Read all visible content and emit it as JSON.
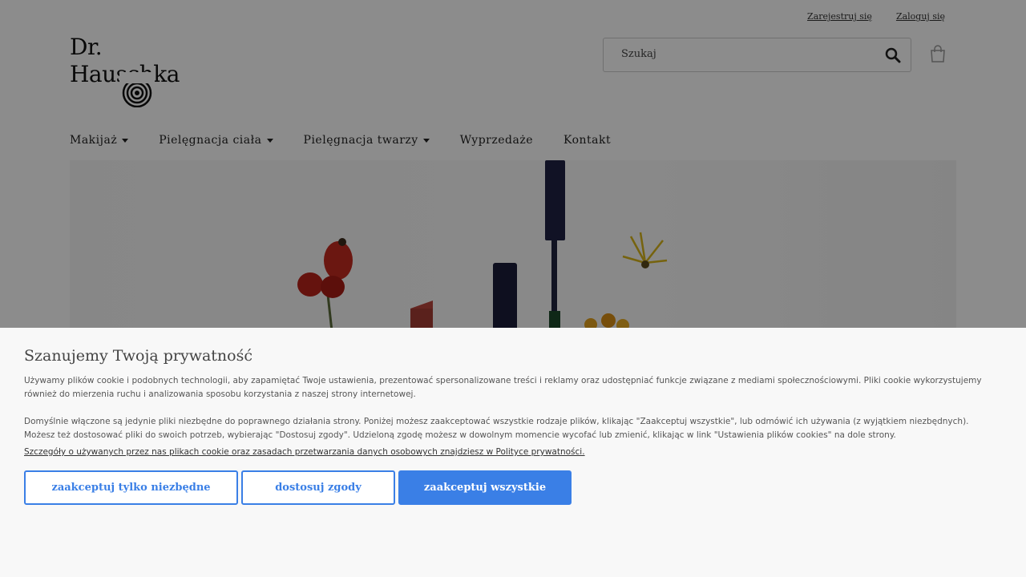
{
  "header": {
    "register_label": "Zarejestruj się",
    "login_label": "Zaloguj się",
    "logo_text": "Dr. Hauschka",
    "search_placeholder": "Szukaj"
  },
  "nav": {
    "items": [
      {
        "label": "Makijaż"
      },
      {
        "label": "Pielęgnacja ciała"
      },
      {
        "label": "Pielęgnacja twarzy"
      },
      {
        "label": "Wyprzedaże"
      },
      {
        "label": "Kontakt"
      }
    ]
  },
  "cookie": {
    "title": "Szanujemy Twoją prywatność",
    "para1": "Używamy plików cookie i podobnych technologii, aby zapamiętać Twoje ustawienia, prezentować spersonalizowane treści i reklamy oraz udostępniać funkcje związane z mediami społecznościowymi. Pliki cookie wykorzystujemy również do mierzenia ruchu i analizowania sposobu korzystania z naszej strony internetowej.",
    "para2": "Domyślnie włączone są jedynie pliki niezbędne do poprawnego działania strony. Poniżej możesz zaakceptować wszystkie rodzaje plików, klikając \"Zaakceptuj wszystkie\", lub odmówić ich używania (z wyjątkiem niezbędnych). Możesz też dostosować pliki do swoich potrzeb, wybierając \"Dostosuj zgody\". Udzieloną zgodę możesz w dowolnym momencie wycofać lub zmienić, klikając w link \"Ustawienia plików cookies\" na dole strony.",
    "policy_link": "Szczegóły o używanych przez nas plikach cookie oraz zasadach przetwarzania danych osobowych znajdziesz w Polityce prywatności.",
    "btn_necessary": "zaakceptuj tylko niezbędne",
    "btn_customize": "dostosuj zgody",
    "btn_accept_all": "zaakceptuj wszystkie"
  },
  "colors": {
    "accent": "#3a7fe6",
    "overlay": "rgba(0,0,0,0.45)"
  }
}
